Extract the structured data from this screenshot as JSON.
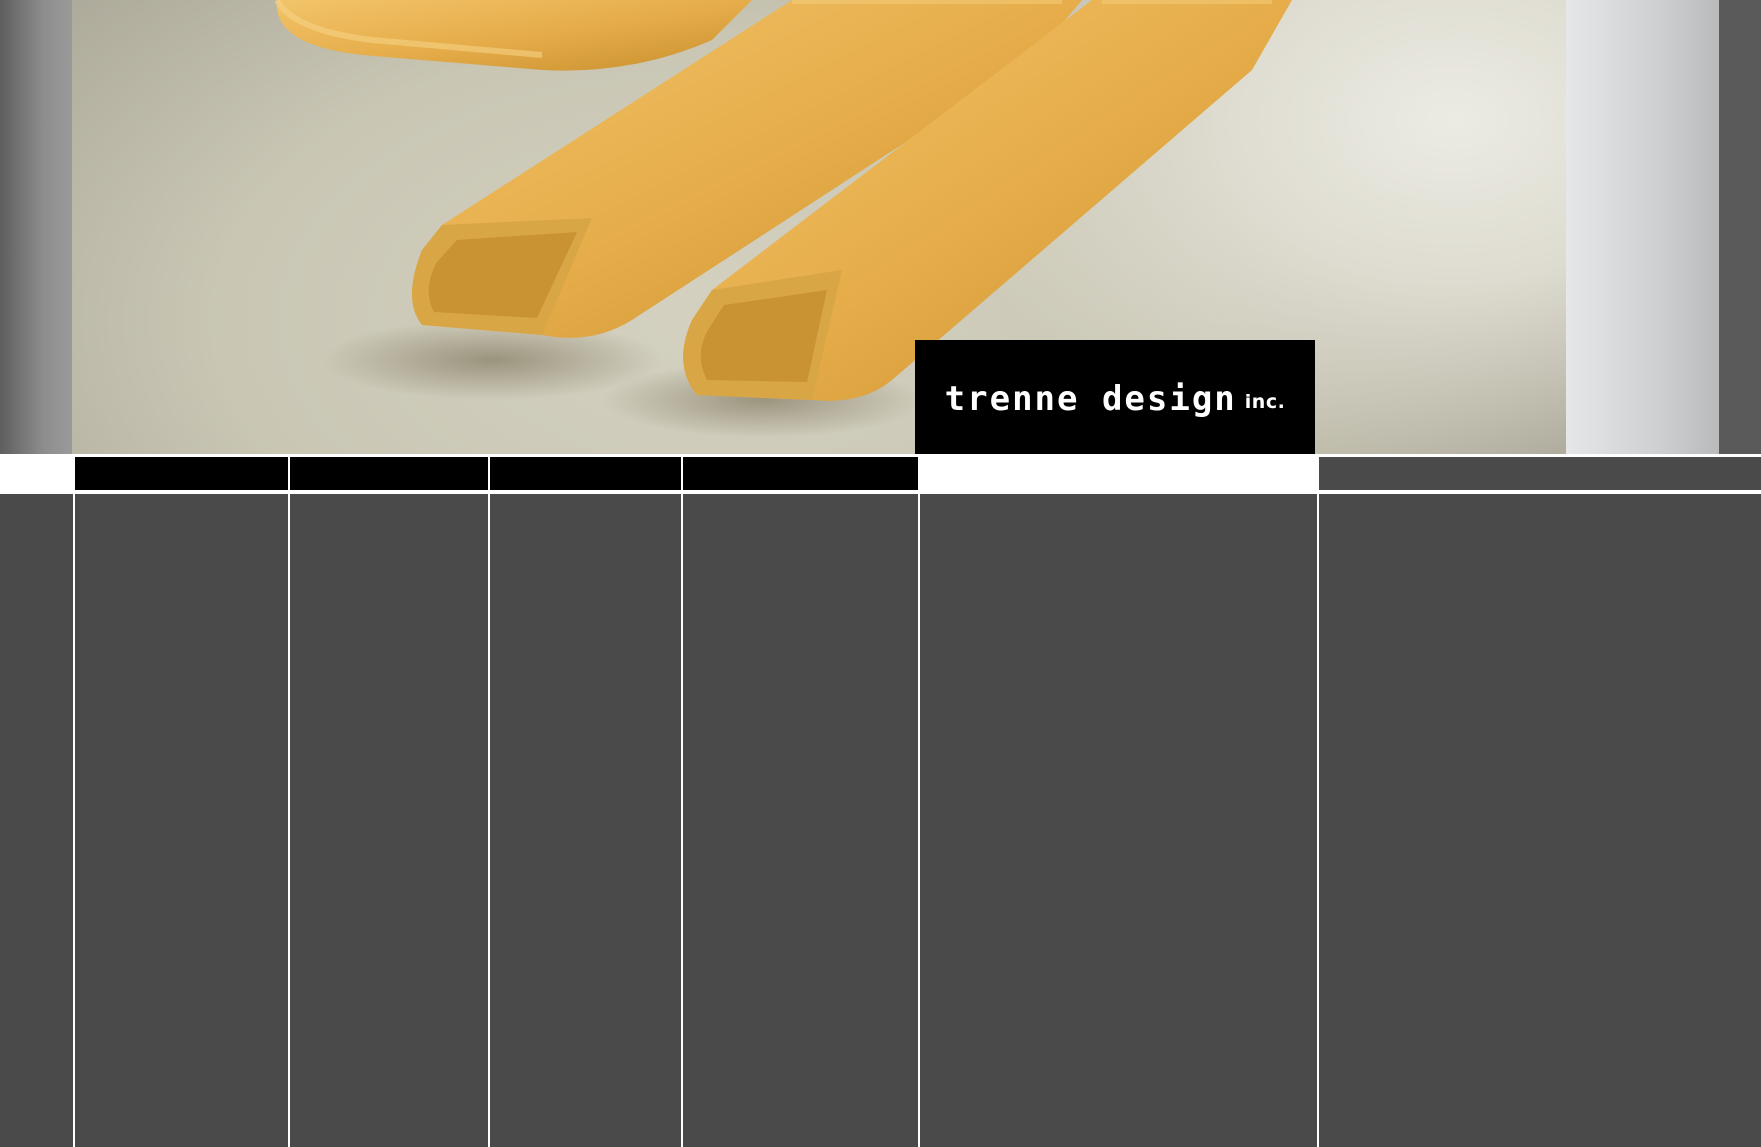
{
  "site": {
    "logo_text": "trenne design",
    "logo_suffix": "inc."
  },
  "hero": {
    "image_description_icon": "pasta-photo"
  },
  "nav": {
    "items": [
      {
        "label": ""
      },
      {
        "label": ""
      },
      {
        "label": ""
      },
      {
        "label": ""
      }
    ]
  },
  "colors": {
    "page_background": "#4a4a4a",
    "nav_item": "#000000",
    "divider": "#ffffff",
    "logo_background": "#000000",
    "logo_text": "#ffffff"
  }
}
